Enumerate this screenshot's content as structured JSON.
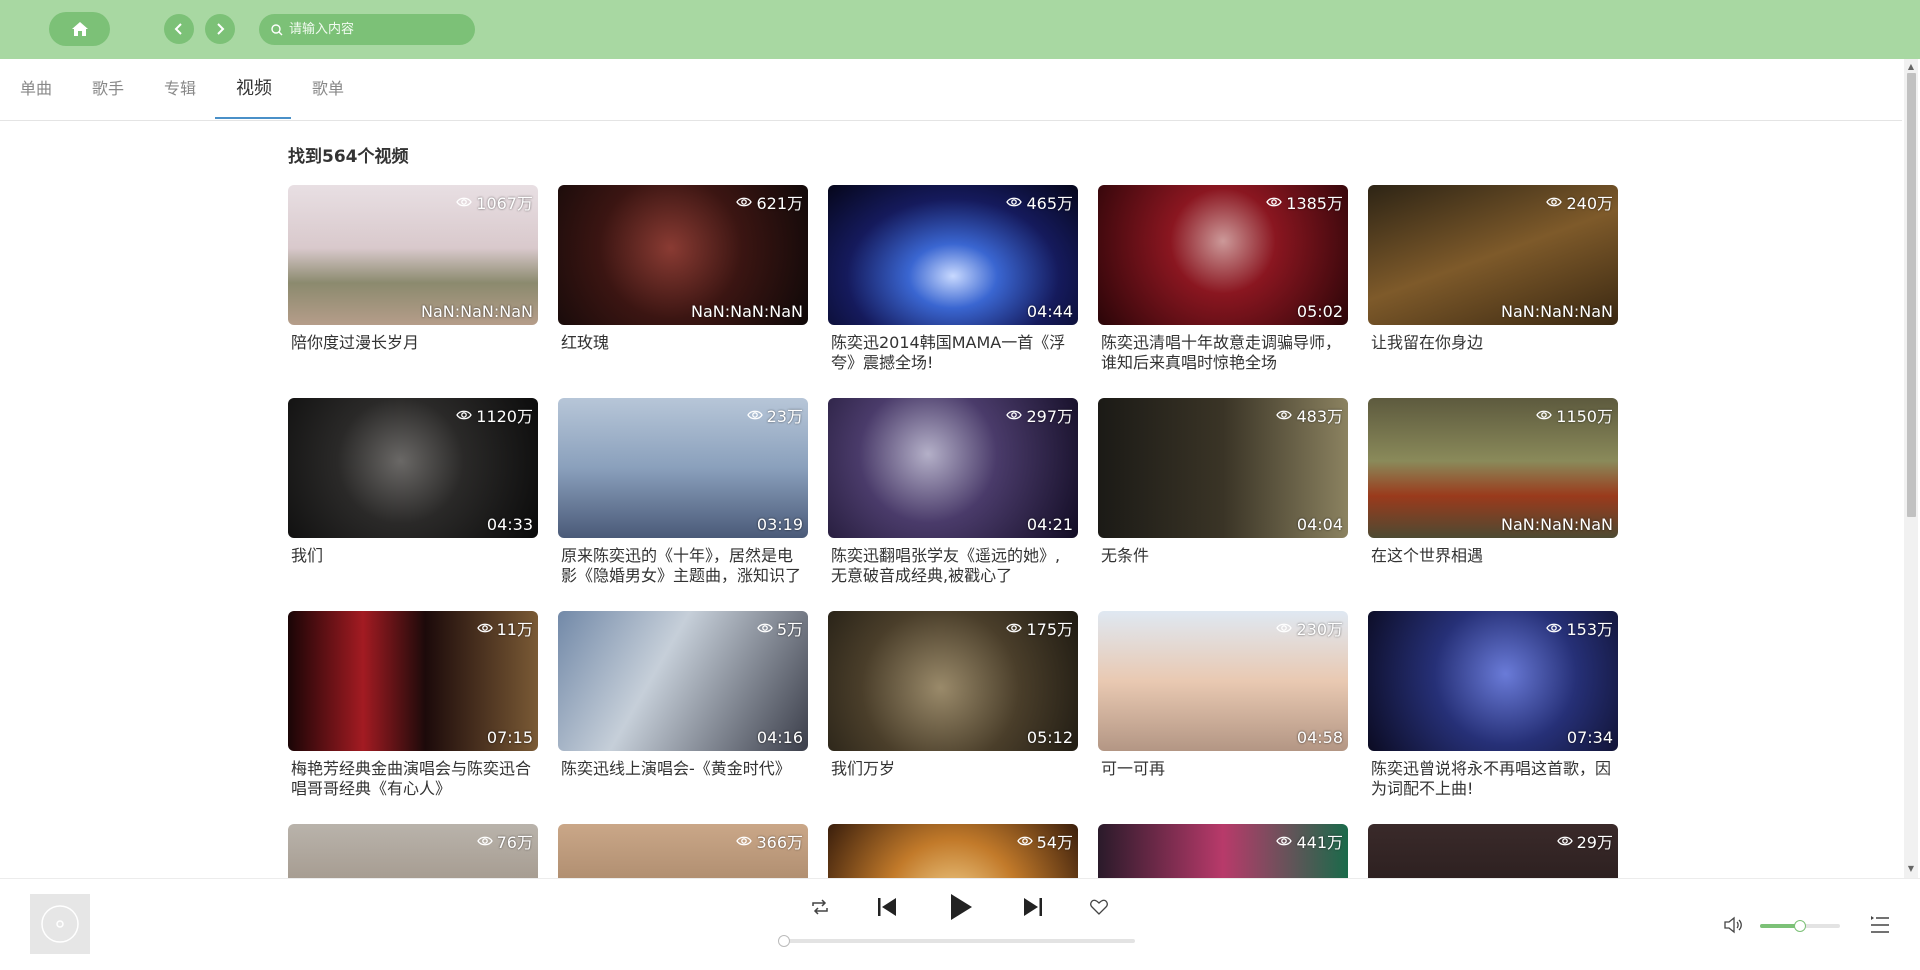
{
  "search": {
    "placeholder": "请输入内容"
  },
  "tabs": [
    {
      "label": "单曲"
    },
    {
      "label": "歌手"
    },
    {
      "label": "专辑"
    },
    {
      "label": "视频",
      "active": true
    },
    {
      "label": "歌单"
    }
  ],
  "results": {
    "count_text": "找到564个视频"
  },
  "videos": [
    {
      "title": "陪你度过漫长岁月",
      "views": "1067万",
      "duration": "NaN:NaN:NaN"
    },
    {
      "title": "红玫瑰",
      "views": "621万",
      "duration": "NaN:NaN:NaN"
    },
    {
      "title": "陈奕迅2014韩国MAMA一首《浮夸》震撼全场!",
      "views": "465万",
      "duration": "04:44"
    },
    {
      "title": "陈奕迅清唱十年故意走调骗导师，谁知后来真唱时惊艳全场",
      "views": "1385万",
      "duration": "05:02"
    },
    {
      "title": "让我留在你身边",
      "views": "240万",
      "duration": "NaN:NaN:NaN"
    },
    {
      "title": "我们",
      "views": "1120万",
      "duration": "04:33"
    },
    {
      "title": "原来陈奕迅的《十年》，居然是电影《隐婚男女》主题曲，涨知识了",
      "views": "23万",
      "duration": "03:19"
    },
    {
      "title": "陈奕迅翻唱张学友《遥远的她》,无意破音成经典,被戳心了",
      "views": "297万",
      "duration": "04:21"
    },
    {
      "title": "无条件",
      "views": "483万",
      "duration": "04:04"
    },
    {
      "title": "在这个世界相遇",
      "views": "1150万",
      "duration": "NaN:NaN:NaN"
    },
    {
      "title": "梅艳芳经典金曲演唱会与陈奕迅合唱哥哥经典《有心人》",
      "views": "11万",
      "duration": "07:15"
    },
    {
      "title": "陈奕迅线上演唱会-《黄金时代》",
      "views": "5万",
      "duration": "04:16"
    },
    {
      "title": "我们万岁",
      "views": "175万",
      "duration": "05:12"
    },
    {
      "title": "可一可再",
      "views": "230万",
      "duration": "04:58"
    },
    {
      "title": "陈奕迅曾说将永不再唱这首歌，因为词配不上曲!",
      "views": "153万",
      "duration": "07:34"
    },
    {
      "title": "",
      "views": "76万",
      "duration": ""
    },
    {
      "title": "",
      "views": "366万",
      "duration": ""
    },
    {
      "title": "",
      "views": "54万",
      "duration": ""
    },
    {
      "title": "",
      "views": "441万",
      "duration": ""
    },
    {
      "title": "",
      "views": "29万",
      "duration": ""
    }
  ],
  "player": {
    "volume": 0.5,
    "progress": 0
  },
  "icons": [
    "home-icon",
    "chevron-left-icon",
    "chevron-right-icon",
    "search-icon",
    "eye-icon",
    "loop-icon",
    "previous-icon",
    "play-icon",
    "next-icon",
    "heart-icon",
    "volume-icon",
    "playlist-icon",
    "disc-icon"
  ],
  "colors": {
    "header": "#a8d8a2",
    "accent": "#7cc177",
    "tab_underline": "#4a90c8"
  }
}
